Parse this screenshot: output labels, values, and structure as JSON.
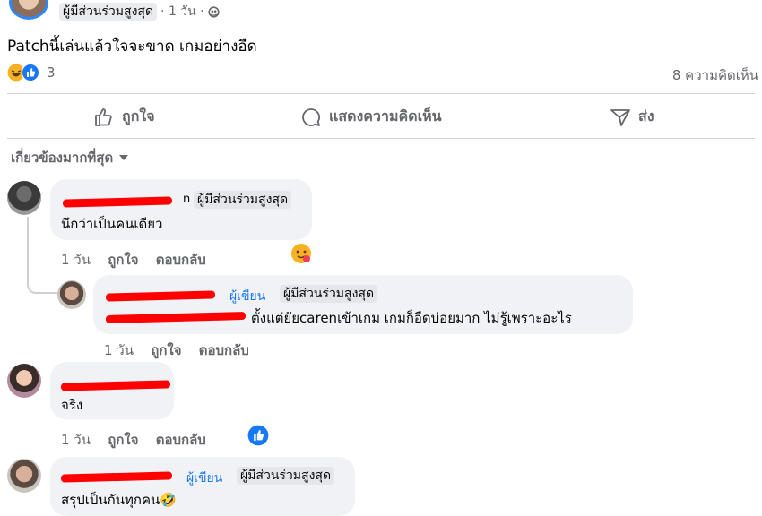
{
  "post": {
    "top_badge": "ผู้มีส่วนร่วมสูงสุด",
    "top_time": "· 1 วัน ·",
    "text": "Patchนี้เล่นแล้วใจจะขาด เกมอย่างอืด",
    "reaction_count": "3",
    "comment_count": "8 ความคิดเห็น"
  },
  "action_bar": {
    "like": "ถูกใจ",
    "comment": "แสดงความคิดเห็น",
    "share": "ส่ง"
  },
  "sort_label": "เกี่ยวข้องมากที่สุด",
  "comments": [
    {
      "name_visible": "n",
      "badge": "ผู้มีส่วนร่วมสูงสุด",
      "text": "นึกว่าเป็นคนเดียว",
      "time": "1 วัน",
      "like": "ถูกใจ",
      "reply": "ตอบกลับ"
    },
    {
      "author_tag": "ผู้เขียน",
      "badge": "ผู้มีส่วนร่วมสูงสุด",
      "text": "ตั้งแต่ยัยcarenเข้าเกม เกมก็อืดบ่อยมาก ไม่รู้เพราะอะไร",
      "time": "1 วัน",
      "like": "ถูกใจ",
      "reply": "ตอบกลับ"
    },
    {
      "text": "จริง",
      "time": "1 วัน",
      "like": "ถูกใจ",
      "reply": "ตอบกลับ"
    },
    {
      "author_tag": "ผู้เขียน",
      "badge": "ผู้มีส่วนร่วมสูงสุด",
      "text": "สรุปเป็นกันทุกคน🤣"
    }
  ],
  "colors": {
    "accent": "#1877f2",
    "redaction": "#ff0000",
    "bubble": "#f0f2f5",
    "muted": "#65676b"
  }
}
